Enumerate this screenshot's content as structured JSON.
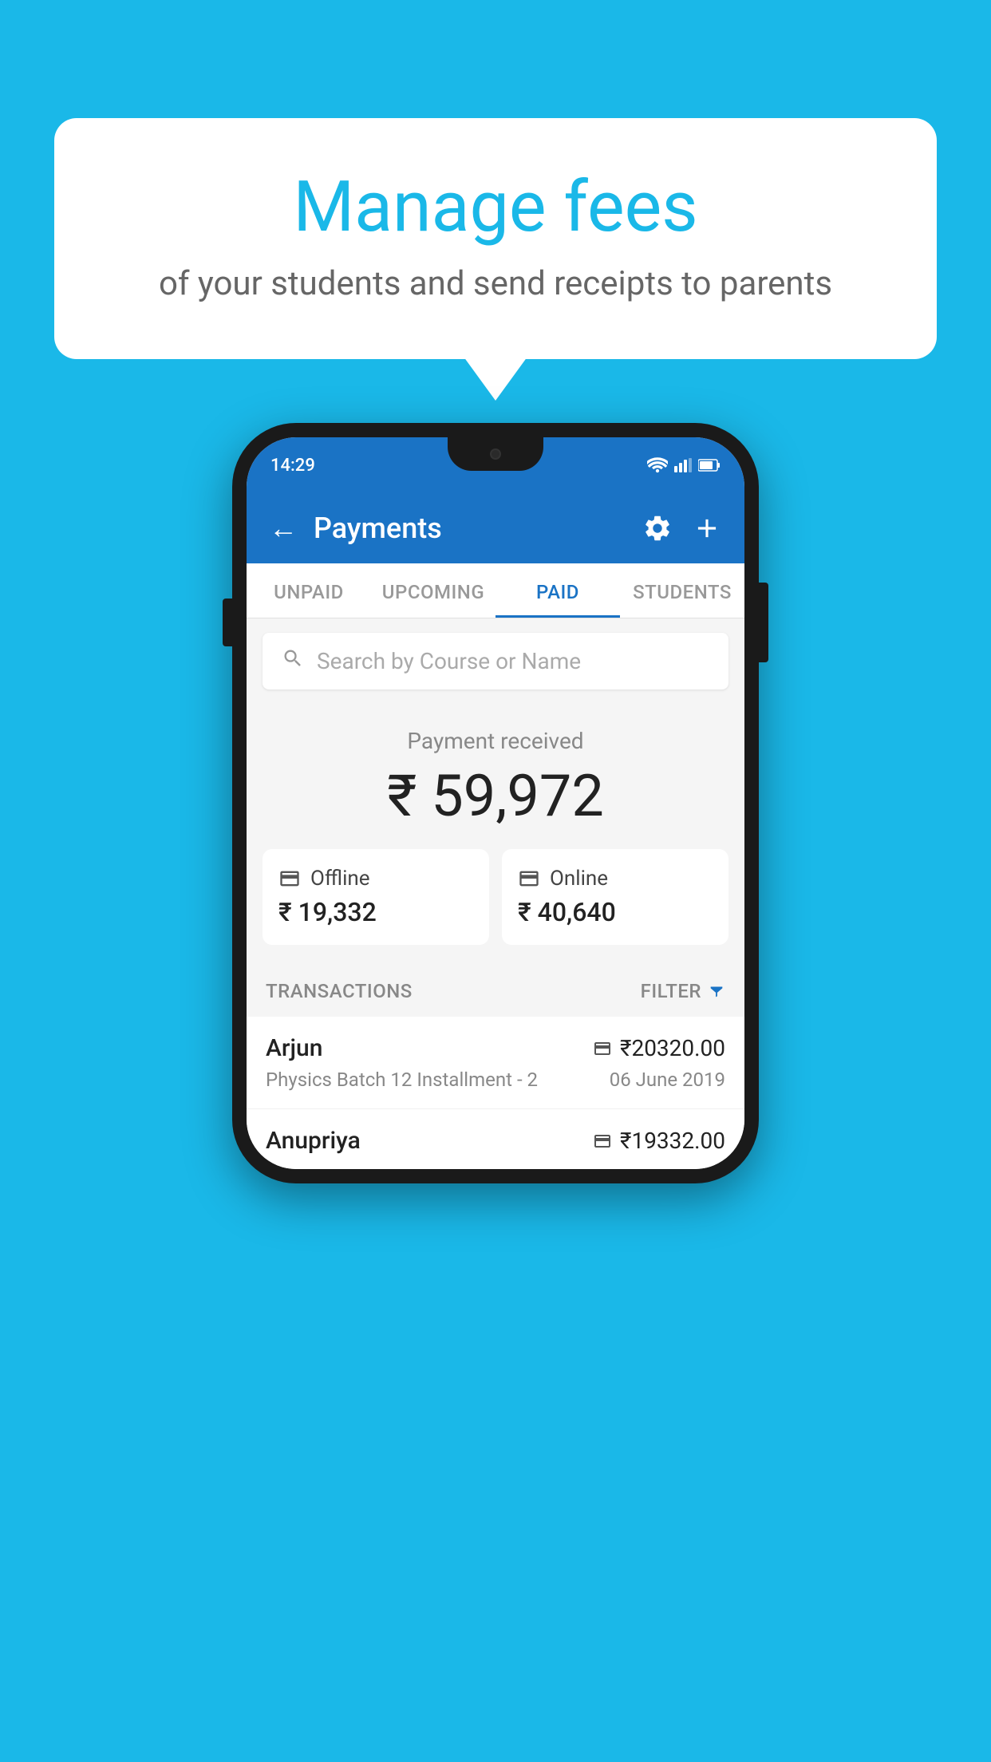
{
  "background_color": "#1ab8e8",
  "speech_bubble": {
    "title": "Manage fees",
    "subtitle": "of your students and send receipts to parents"
  },
  "phone": {
    "status_bar": {
      "time": "14:29"
    },
    "header": {
      "title": "Payments",
      "back_label": "←",
      "settings_icon": "gear-icon",
      "add_icon": "plus-icon"
    },
    "tabs": [
      {
        "label": "UNPAID",
        "active": false
      },
      {
        "label": "UPCOMING",
        "active": false
      },
      {
        "label": "PAID",
        "active": true
      },
      {
        "label": "STUDENTS",
        "active": false
      }
    ],
    "search": {
      "placeholder": "Search by Course or Name"
    },
    "payment_summary": {
      "label": "Payment received",
      "total": "₹ 59,972",
      "offline": {
        "type": "Offline",
        "amount": "₹ 19,332"
      },
      "online": {
        "type": "Online",
        "amount": "₹ 40,640"
      }
    },
    "transactions_section": {
      "label": "TRANSACTIONS",
      "filter_label": "FILTER"
    },
    "transactions": [
      {
        "name": "Arjun",
        "amount": "₹20320.00",
        "detail": "Physics Batch 12 Installment - 2",
        "date": "06 June 2019",
        "payment_type": "card"
      },
      {
        "name": "Anupriya",
        "amount": "₹19332.00",
        "detail": "",
        "date": "",
        "payment_type": "offline"
      }
    ]
  }
}
